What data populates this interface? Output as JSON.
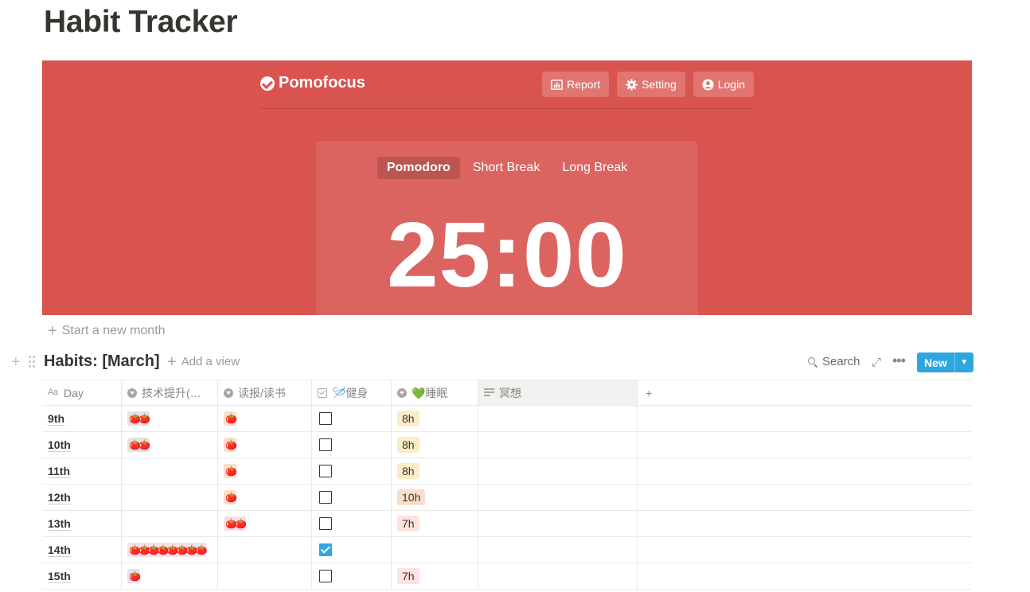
{
  "page": {
    "title": "Habit Tracker"
  },
  "pomofocus": {
    "brand": "Pomofocus",
    "nav": [
      {
        "label": "Report",
        "icon": "bar-chart-icon"
      },
      {
        "label": "Setting",
        "icon": "gear-icon"
      },
      {
        "label": "Login",
        "icon": "user-circle-icon"
      }
    ],
    "modes": [
      "Pomodoro",
      "Short Break",
      "Long Break"
    ],
    "active_mode": "Pomodoro",
    "timer": "25:00",
    "colors": {
      "background": "#d9534f"
    }
  },
  "start_month_label": "Start a new month",
  "database": {
    "title": "Habits: [March]",
    "add_view_label": "Add a view",
    "search_label": "Search",
    "new_label": "New",
    "accent": "#2ea7e0",
    "columns": [
      {
        "label": "Day",
        "icon": "text-title-icon"
      },
      {
        "label": "技术提升(…",
        "icon": "select-icon"
      },
      {
        "label": "读报/读书",
        "icon": "select-icon"
      },
      {
        "label": "🪡健身",
        "icon": "checkbox-icon"
      },
      {
        "label": "💚睡眠",
        "icon": "select-icon"
      },
      {
        "label": "冥想",
        "icon": "text-icon"
      }
    ],
    "rows": [
      {
        "day": "9th",
        "tech": "🍅🍅",
        "read": "🍅",
        "gym": false,
        "sleep": "8h",
        "meditate": ""
      },
      {
        "day": "10th",
        "tech": "🍅🍅",
        "read": "🍅",
        "gym": false,
        "sleep": "8h",
        "meditate": ""
      },
      {
        "day": "11th",
        "tech": "",
        "read": "🍅",
        "gym": false,
        "sleep": "8h",
        "meditate": ""
      },
      {
        "day": "12th",
        "tech": "",
        "read": "🍅",
        "gym": false,
        "sleep": "10h",
        "meditate": ""
      },
      {
        "day": "13th",
        "tech": "",
        "read": "🍅🍅",
        "gym": false,
        "sleep": "7h",
        "meditate": ""
      },
      {
        "day": "14th",
        "tech": "🍅🍅🍅🍅🍅🍅🍅🍅",
        "read": "",
        "gym": true,
        "sleep": "",
        "meditate": ""
      },
      {
        "day": "15th",
        "tech": "🍅",
        "read": "",
        "gym": false,
        "sleep": "7h",
        "meditate": ""
      }
    ]
  }
}
